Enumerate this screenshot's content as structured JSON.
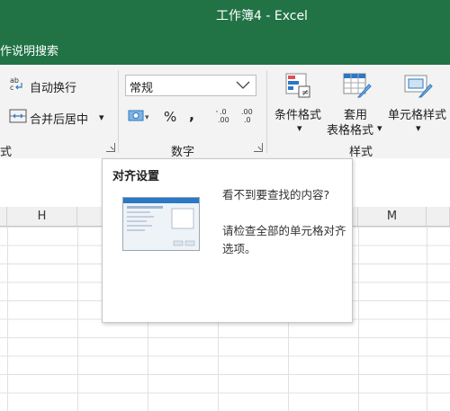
{
  "window": {
    "title": "工作簿4  -  Excel"
  },
  "tell_me": {
    "label": "作说明搜索"
  },
  "ribbon": {
    "alignment": {
      "wrap_text": "自动换行",
      "merge_center": "合并后居中",
      "group_label": "式"
    },
    "number": {
      "format_value": "常规",
      "percent": "%",
      "comma": ",",
      "inc_decimal": ".0\n.00",
      "dec_decimal": ".00\n.0",
      "group_label": "数字"
    },
    "styles": {
      "conditional_format": "条件格式",
      "format_table_1": "套用",
      "format_table_2": "表格格式",
      "cell_styles": "单元格样式",
      "group_label": "样式"
    }
  },
  "columns": {
    "h": "H",
    "m": "M"
  },
  "tooltip": {
    "title": "对齐设置",
    "line1": "看不到要查找的内容?",
    "line2": "请检查全部的单元格对齐选项。"
  }
}
